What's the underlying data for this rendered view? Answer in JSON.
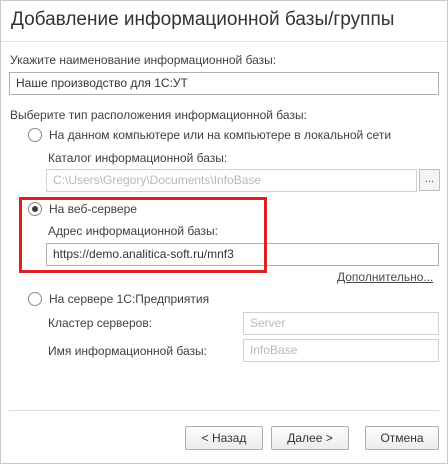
{
  "dialog": {
    "title": "Добавление информационной базы/группы"
  },
  "name_section": {
    "label": "Укажите наименование информационной базы:",
    "value": "Наше производство для 1С:УТ"
  },
  "location_section": {
    "label": "Выберите тип расположения информационной базы:",
    "local": {
      "label": "На данном компьютере или на компьютере в локальной сети",
      "selected": false,
      "catalog_label": "Каталог информационной базы:",
      "catalog_value": "C:\\Users\\Gregory\\Documents\\InfoBase",
      "browse_label": "..."
    },
    "web": {
      "label": "На веб-сервере",
      "selected": true,
      "address_label": "Адрес информационной базы:",
      "address_value": "https://demo.analitica-soft.ru/mnf3"
    },
    "more_link": "Дополнительно...",
    "server": {
      "label": "На сервере 1С:Предприятия",
      "selected": false,
      "cluster_label": "Кластер серверов:",
      "cluster_placeholder": "Server",
      "db_name_label": "Имя информационной базы:",
      "db_name_placeholder": "InfoBase"
    }
  },
  "buttons": {
    "back": "< Назад",
    "next": "Далее >",
    "cancel": "Отмена"
  },
  "colors": {
    "highlight": "#e02020",
    "text": "#333333",
    "disabled_text": "#b8b8b8"
  }
}
